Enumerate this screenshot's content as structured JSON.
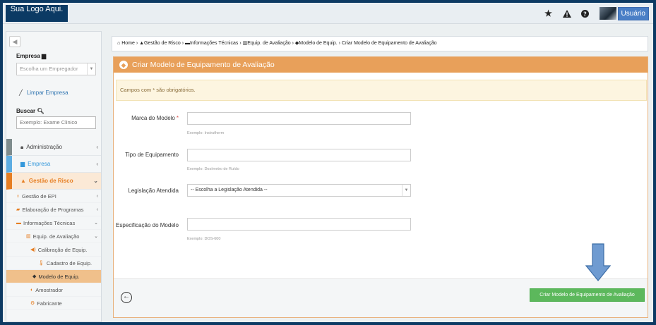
{
  "header": {
    "logo_text": "Sua Logo Aqui.",
    "icons": [
      "star-icon",
      "warning-icon",
      "help-icon"
    ],
    "user_label": "Usuário"
  },
  "sidebar": {
    "toggle_icon": "circle-arrow-left-icon",
    "empresa_label": "Empresa",
    "empresa_placeholder": "Escolha um Empregador",
    "clear_label": "Limpar Empresa",
    "search_label": "Buscar",
    "search_placeholder": "Exemplo: Exame Clinico",
    "menu": {
      "administracao": "Administração",
      "empresa": "Empresa",
      "gestao_risco": "Gestão de Risco",
      "gestao_epi": "Gestão de EPI",
      "elaboracao": "Elaboração de Programas",
      "informacoes": "Informações Técnicas",
      "equip_avaliacao": "Equip. de Avaliação",
      "calibracao": "Calibração de Equip.",
      "cadastro": "Cadastro de Equip.",
      "modelo": "Modelo de Equip.",
      "amostrador": "Amostrador",
      "fabricante": "Fabricante"
    }
  },
  "breadcrumb": {
    "items": [
      "Home",
      "Gestão de Risco",
      "Informações Técnicas",
      "Equip. de Avaliação",
      "Modelo de Equip.",
      "Criar Modelo de Equipamento de Avaliação"
    ]
  },
  "panel": {
    "title": "Criar Modelo de Equipamento de Avaliação",
    "notice": "Campos com * são obrigatórios.",
    "fields": {
      "marca_label": "Marca do Modelo",
      "marca_req": "*",
      "marca_help": "Exemplo: Instrutherm",
      "tipo_label": "Tipo de Equipamento",
      "tipo_help": "Exemplo: Dosímetro de Ruído",
      "legislacao_label": "Legislação Atendida",
      "legislacao_selected": "-- Escolha a Legislação Atendida --",
      "especificacao_label": "Especificação do Modelo",
      "especificacao_help": "Exemplo: DOS-600"
    },
    "submit_label": "Criar Modelo de Equipamento de Avaliação"
  },
  "colors": {
    "accent_orange": "#e8a05a",
    "submit_green": "#5cb85c",
    "user_blue": "#4a7fc6",
    "frame_navy": "#0d3a63"
  }
}
